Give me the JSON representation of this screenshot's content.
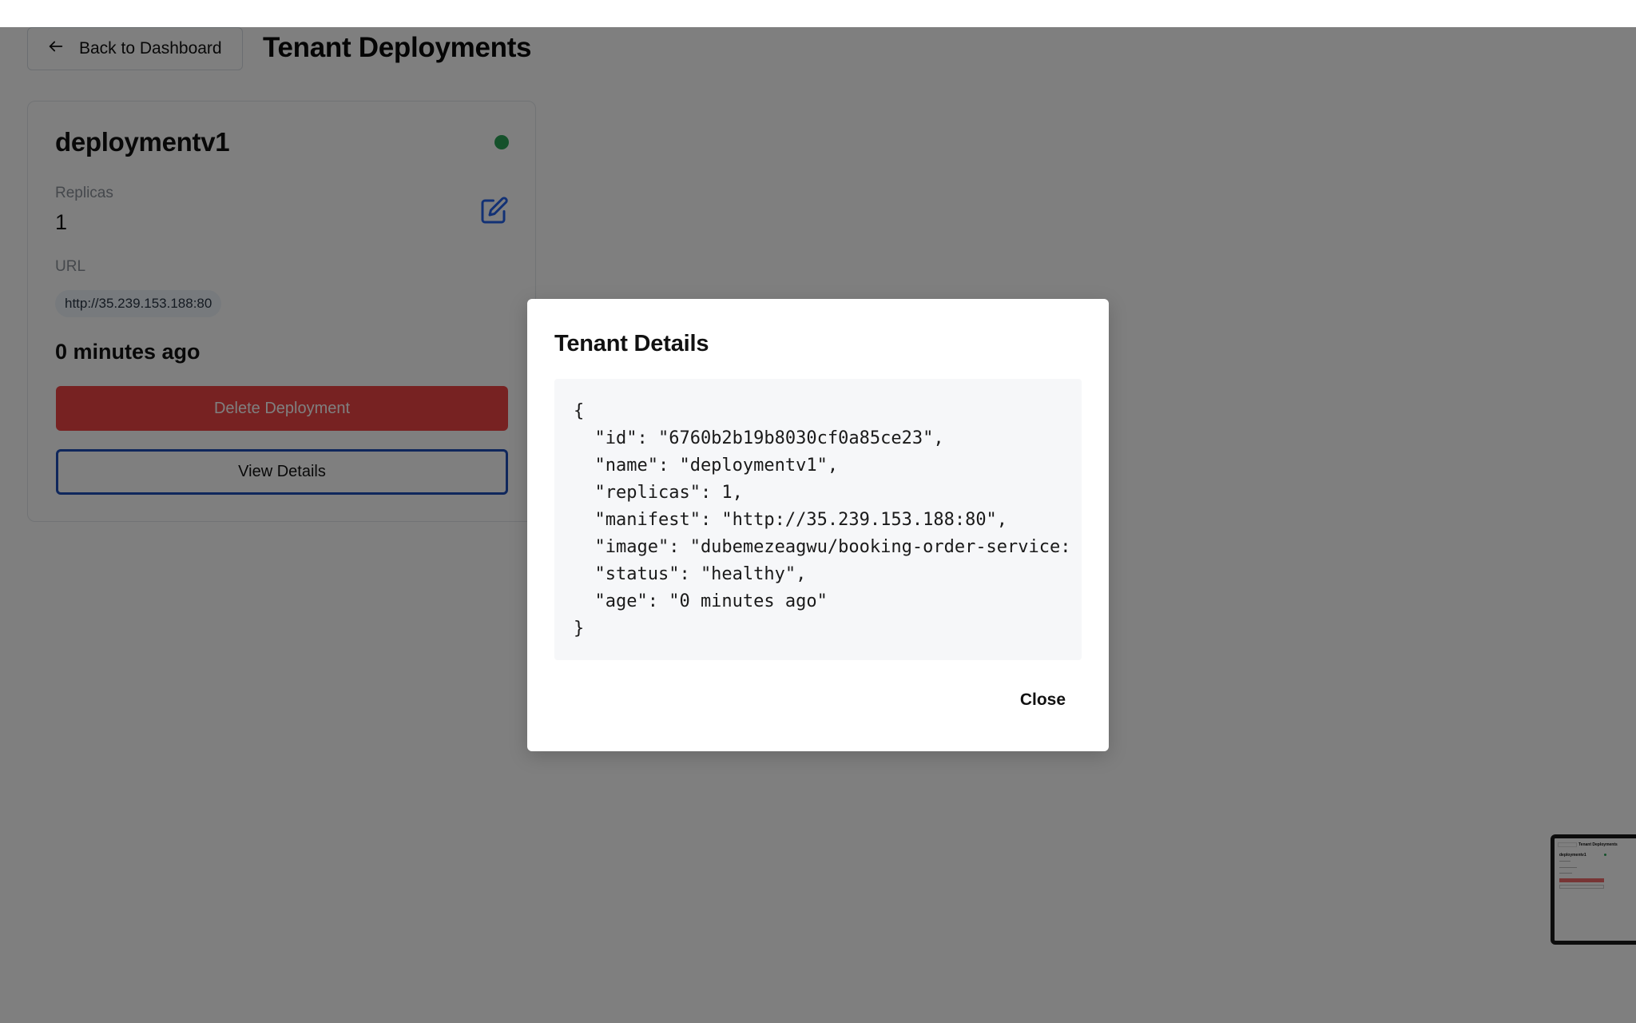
{
  "header": {
    "back_label": "Back to Dashboard",
    "title": "Tenant Deployments"
  },
  "deployment_card": {
    "name": "deploymentv1",
    "status_color": "#2aa356",
    "replicas_label": "Replicas",
    "replicas_value": "1",
    "url_label": "URL",
    "url_value": "http://35.239.153.188:80",
    "age": "0 minutes ago",
    "delete_label": "Delete Deployment",
    "view_details_label": "View Details"
  },
  "modal": {
    "title": "Tenant Details",
    "json_text": "{\n  \"id\": \"6760b2b19b8030cf0a85ce23\",\n  \"name\": \"deploymentv1\",\n  \"replicas\": 1,\n  \"manifest\": \"http://35.239.153.188:80\",\n  \"image\": \"dubemezeagwu/booking-order-service:\n  \"status\": \"healthy\",\n  \"age\": \"0 minutes ago\"\n}",
    "close_label": "Close"
  },
  "thumbnail": {
    "title": "Tenant Deployments",
    "card_name": "deploymentv1"
  },
  "colors": {
    "danger": "#ef4444",
    "primary_border": "#1e4fb8",
    "status_ok": "#2aa356",
    "edit_icon": "#2563eb"
  }
}
